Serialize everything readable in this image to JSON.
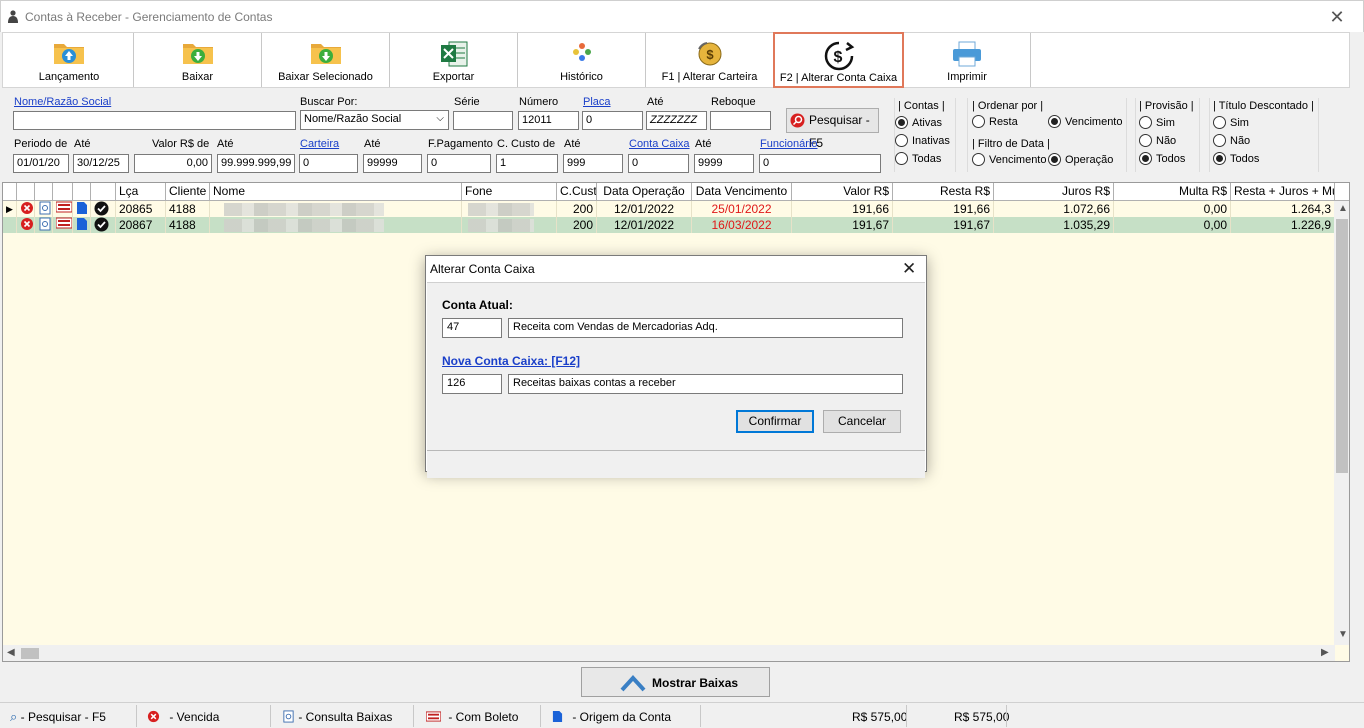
{
  "window": {
    "title": "Contas à Receber - Gerenciamento de Contas"
  },
  "toolbar": {
    "buttons": [
      {
        "label": "Lançamento",
        "icon": "folder-upload-icon"
      },
      {
        "label": "Baixar",
        "icon": "folder-download-icon"
      },
      {
        "label": "Baixar Selecionado",
        "icon": "folder-download-icon"
      },
      {
        "label": "Exportar",
        "icon": "excel-icon"
      },
      {
        "label": "Histórico",
        "icon": "history-icon"
      },
      {
        "label": "F1 | Alterar Carteira",
        "icon": "coin-exchange-icon"
      },
      {
        "label": "F2 | Alterar Conta Caixa",
        "icon": "dollar-refresh-icon"
      },
      {
        "label": "Imprimir",
        "icon": "printer-icon"
      }
    ]
  },
  "filters": {
    "nome_label": "Nome/Razão Social",
    "nome_value": "",
    "buscar_por_label": "Buscar Por:",
    "buscar_por_value": "Nome/Razão Social",
    "serie_label": "Série",
    "serie_value": "",
    "numero_label": "Número",
    "numero_value": "12011",
    "placa_label": "Placa",
    "placa_value": "0",
    "placa_ate_label": "Até",
    "placa_ate_value": "ZZZZZZZ",
    "reboque_label": "Reboque",
    "reboque_value": "",
    "pesquisar_label": "Pesquisar - F5",
    "periodo_label": "Periodo de",
    "periodo_de": "01/01/20",
    "periodo_ate_label": "Até",
    "periodo_ate": "30/12/25",
    "valor_label": "Valor R$ de",
    "valor_de": "0,00",
    "valor_ate_label": "Até",
    "valor_ate": "99.999.999,99",
    "carteira_label": "Carteira",
    "carteira_de": "0",
    "carteira_ate_label": "Até",
    "carteira_ate": "99999",
    "fpag_label": "F.Pagamento",
    "fpag_value": "0",
    "ccusto_label": "C. Custo de",
    "ccusto_de": "1",
    "ccusto_ate_label": "Até",
    "ccusto_ate": "999",
    "conta_caixa_label": "Conta Caixa",
    "conta_caixa_de": "0",
    "conta_caixa_ate_label": "Até",
    "conta_caixa_ate": "9999",
    "funcionario_label": "Funcionário",
    "funcionario_value": "0"
  },
  "groups": {
    "contas": {
      "title": "| Contas |",
      "options": [
        "Ativas",
        "Inativas",
        "Todas"
      ],
      "selected": "Ativas"
    },
    "ordenar": {
      "title": "| Ordenar por |",
      "options": [
        "Resta",
        "Vencimento"
      ],
      "selected": "Vencimento"
    },
    "filtro_data": {
      "title": "| Filtro de Data |",
      "options": [
        "Vencimento",
        "Operação"
      ],
      "selected": "Operação"
    },
    "provisao": {
      "title": "| Provisão |",
      "options": [
        "Sim",
        "Não",
        "Todos"
      ],
      "selected": "Todos"
    },
    "titulo": {
      "title": "| Título Descontado |",
      "options": [
        "Sim",
        "Não",
        "Todos"
      ],
      "selected": "Todos"
    }
  },
  "grid": {
    "columns": [
      "Lça",
      "Cliente",
      "Nome",
      "Fone",
      "C.Custo",
      "Data Operação",
      "Data Vencimento",
      "Valor R$",
      "Resta R$",
      "Juros R$",
      "Multa R$",
      "Resta + Juros + Multa"
    ],
    "rows": [
      {
        "lca": "20865",
        "cliente": "4188",
        "nome": "",
        "fone": "",
        "ccusto": "200",
        "data_op": "12/01/2022",
        "data_venc": "25/01/2022",
        "valor": "191,66",
        "resta": "191,66",
        "juros": "1.072,66",
        "multa": "0,00",
        "total": "1.264,3"
      },
      {
        "lca": "20867",
        "cliente": "4188",
        "nome": "",
        "fone": "",
        "ccusto": "200",
        "data_op": "12/01/2022",
        "data_venc": "16/03/2022",
        "valor": "191,67",
        "resta": "191,67",
        "juros": "1.035,29",
        "multa": "0,00",
        "total": "1.226,9"
      }
    ]
  },
  "bottom": {
    "mostrar_label": "Mostrar Baixas"
  },
  "status": {
    "items": [
      {
        "label": "- Pesquisar - F5",
        "icon": "search-icon"
      },
      {
        "label": "- Vencida",
        "icon": "error-circle-icon"
      },
      {
        "label": "- Consulta Baixas",
        "icon": "document-search-icon"
      },
      {
        "label": "- Com Boleto",
        "icon": "barcode-icon"
      },
      {
        "label": "- Origem da Conta",
        "icon": "document-icon"
      }
    ],
    "total1": "R$ 575,00",
    "total2": "R$ 575,00"
  },
  "dialog": {
    "title": "Alterar Conta Caixa",
    "atual_label": "Conta Atual:",
    "atual_code": "47",
    "atual_desc": "Receita com Vendas de Mercadorias Adq.",
    "nova_label": "Nova Conta Caixa: [F12]",
    "nova_code": "126",
    "nova_desc": "Receitas baixas contas a receber",
    "confirm_label": "Confirmar",
    "cancel_label": "Cancelar"
  },
  "colors": {
    "grid_bg": "#fffbe6",
    "selected_row": "#c6e0c6",
    "link": "#1a3fc9",
    "overdue": "#e01818",
    "active_border": "#e0785a"
  }
}
